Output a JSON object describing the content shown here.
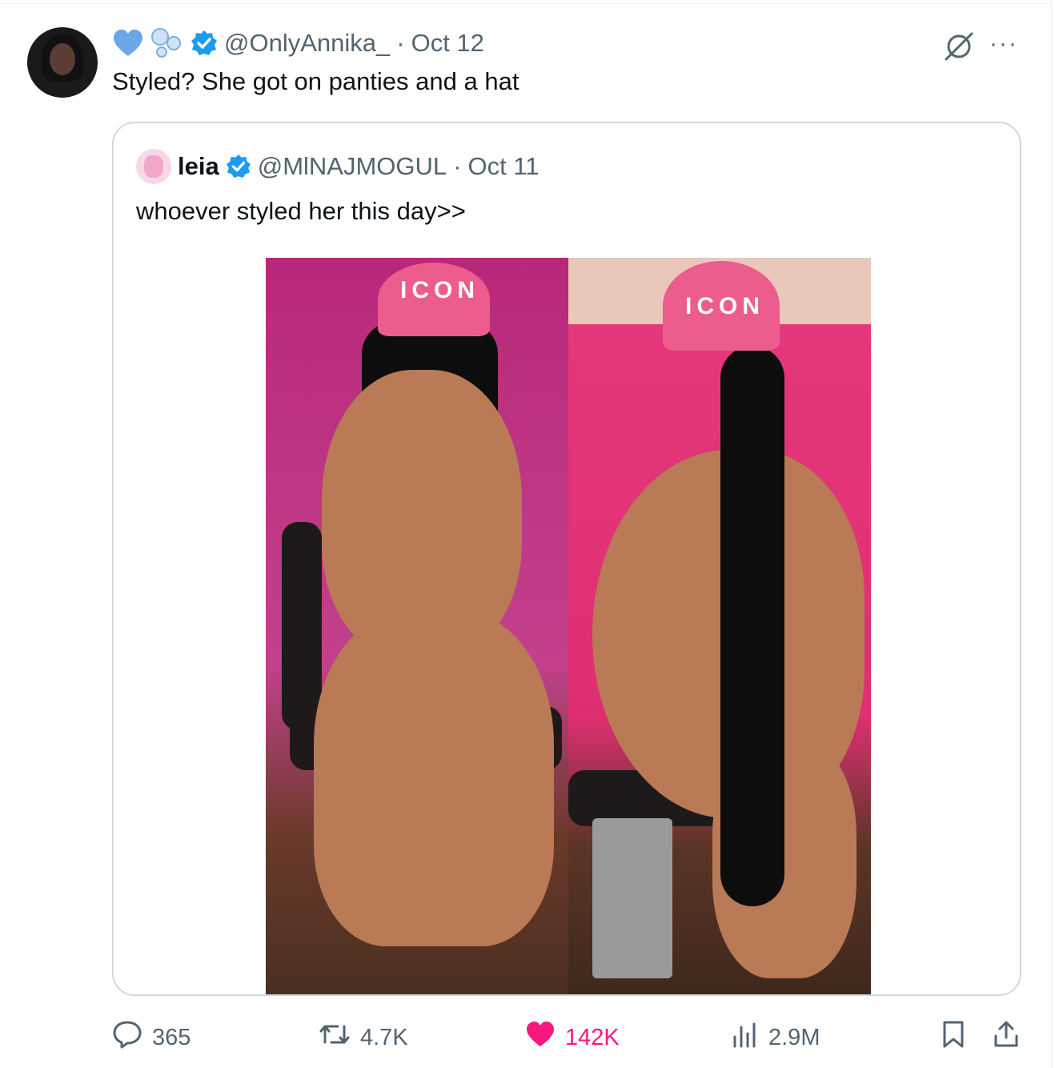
{
  "tweet": {
    "handle": "@OnlyAnnika_",
    "separator": "·",
    "date": "Oct 12",
    "text": "Styled? She got on panties and a hat",
    "more_label": "···"
  },
  "quote": {
    "name": "leia",
    "handle": "@MlNAJMOGUL",
    "separator": "·",
    "date": "Oct 11",
    "text": "whoever styled her this day>>",
    "photo_left_cap_text": "ICON",
    "photo_right_cap_text": "ICON"
  },
  "actions": {
    "replies": "365",
    "reposts": "4.7K",
    "likes": "142K",
    "views": "2.9M"
  },
  "colors": {
    "verified": "#1d9bf0",
    "like": "#f91880",
    "muted": "#536471",
    "border": "#cfd9de"
  }
}
